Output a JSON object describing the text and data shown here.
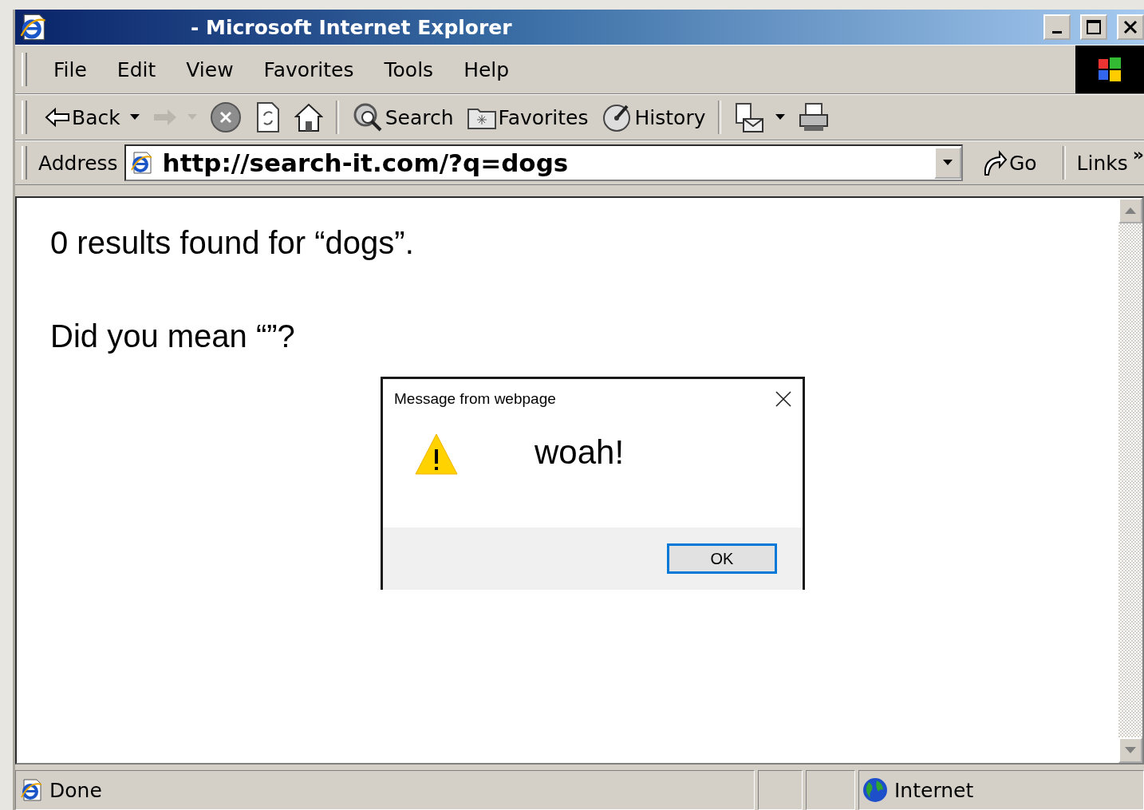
{
  "window": {
    "title": "- Microsoft Internet Explorer"
  },
  "menu": [
    "File",
    "Edit",
    "View",
    "Favorites",
    "Tools",
    "Help"
  ],
  "toolbar": [
    {
      "kind": "back",
      "label": "Back",
      "dropdown": true,
      "disabled": false
    },
    {
      "kind": "forward",
      "dropdown": true,
      "disabled": true
    },
    {
      "kind": "stop",
      "disabled": false
    },
    {
      "kind": "refresh",
      "disabled": false
    },
    {
      "kind": "home",
      "disabled": false
    },
    {
      "kind": "separator"
    },
    {
      "kind": "search",
      "label": "Search",
      "disabled": false
    },
    {
      "kind": "favorites",
      "label": "Favorites",
      "disabled": false
    },
    {
      "kind": "history",
      "label": "History",
      "disabled": false
    },
    {
      "kind": "separator"
    },
    {
      "kind": "mail",
      "dropdown": true,
      "disabled": false
    },
    {
      "kind": "print",
      "disabled": false
    }
  ],
  "address": {
    "label": "Address",
    "value": "http://search-it.com/?q=dogs",
    "go": "Go",
    "links": "Links",
    "more": "»"
  },
  "page": {
    "paragraphs": [
      "0 results found for “dogs”.",
      "Did you mean “”?"
    ]
  },
  "dialog": {
    "title": "Message from webpage",
    "message": "woah!",
    "button": "OK"
  },
  "status": {
    "text": "Done",
    "zone": "Internet"
  }
}
